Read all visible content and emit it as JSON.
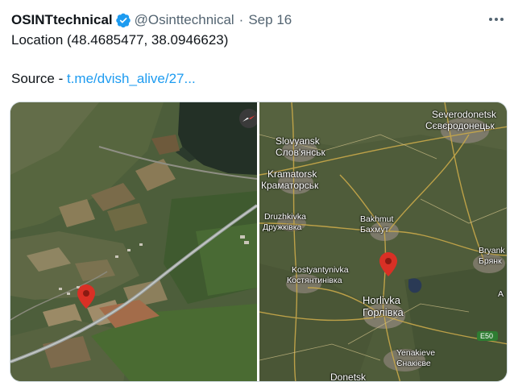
{
  "tweet": {
    "author_name": "OSINTtechnical",
    "handle": "@Osinttechnical",
    "separator": "·",
    "date": "Sep 16",
    "location_text": "Location (48.4685477, 38.0946623)",
    "source_label": "Source - ",
    "source_link": "t.me/dvish_alive/27..."
  },
  "icons": {
    "verified": "verified-badge-icon",
    "more": "more-options-icon",
    "pin": "map-pin-icon",
    "compass": "compass-icon"
  },
  "colors": {
    "link": "#1d9bf0",
    "verified": "#1d9bf0",
    "pin": "#d93025",
    "text_secondary": "#536471"
  },
  "map_right": {
    "labels": {
      "severodonetsk_en": "Severodonetsk",
      "severodonetsk_uk": "Сєвєродонецьк",
      "slovyansk_en": "Slovyansk",
      "slovyansk_uk": "Слов'янськ",
      "kramatorsk_en": "Kramatorsk",
      "kramatorsk_uk": "Краматорськ",
      "druzhkivka_en": "Druzhkivka",
      "druzhkivka_uk": "Дружківка",
      "bakhmut_en": "Bakhmut",
      "bakhmut_uk": "Бахмут",
      "kostyantynivka_en": "Kostyantynivka",
      "kostyantynivka_uk": "Костянтинівка",
      "horlivka_en": "Horlivka",
      "horlivka_uk": "Горлівка",
      "bryank_en": "Bryank",
      "bryank_uk": "Брянк",
      "yenakieve_en": "Yenakieve",
      "yenakieve_uk": "Єнакієве",
      "donetsk": "Donetsk",
      "partial_a": "A",
      "road": "E50"
    }
  }
}
